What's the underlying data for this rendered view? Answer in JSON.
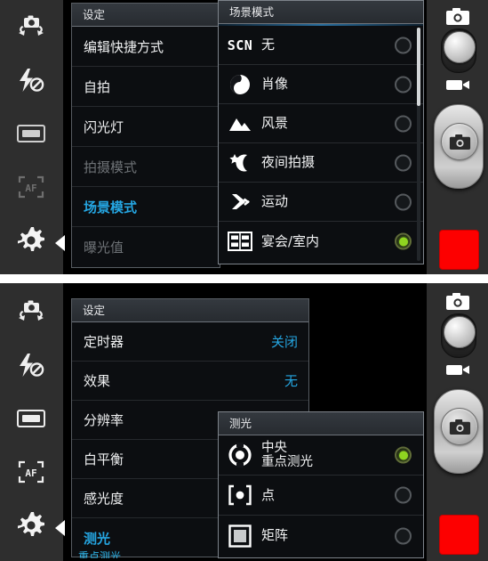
{
  "screens": [
    {
      "id": "scene-mode-screen",
      "sidebar": {
        "items": [
          {
            "name": "camera-switch-icon",
            "state": "enabled"
          },
          {
            "name": "flash-off-icon",
            "state": "enabled"
          },
          {
            "name": "screen-frame-icon",
            "state": "enabled"
          },
          {
            "name": "autofocus-icon",
            "state": "disabled"
          },
          {
            "name": "settings-gear-icon",
            "state": "selected"
          }
        ]
      },
      "settings_panel": {
        "title": "设定",
        "rows": [
          {
            "label": "编辑快捷方式",
            "value": "",
            "state": "normal"
          },
          {
            "label": "自拍",
            "value": "",
            "state": "normal"
          },
          {
            "label": "闪光灯",
            "value": "",
            "state": "normal"
          },
          {
            "label": "拍摄模式",
            "value": "",
            "state": "disabled"
          },
          {
            "label": "场景模式",
            "value": "",
            "state": "active"
          },
          {
            "label": "曝光值",
            "value": "",
            "state": "disabled"
          }
        ]
      },
      "option_panel": {
        "title": "场景模式",
        "options": [
          {
            "icon": "scn-text-icon",
            "label": "无",
            "selected": false
          },
          {
            "icon": "portrait-icon",
            "label": "肖像",
            "selected": false
          },
          {
            "icon": "landscape-icon",
            "label": "风景",
            "selected": false
          },
          {
            "icon": "night-icon",
            "label": "夜间拍摄",
            "selected": false
          },
          {
            "icon": "sports-icon",
            "label": "运动",
            "selected": false
          },
          {
            "icon": "party-indoor-icon",
            "label": "宴会/室内",
            "selected": true
          }
        ],
        "scroll_position": "top"
      },
      "controls": {
        "photo_mode_icon": "camera-icon",
        "video_mode_icon": "video-camera-icon",
        "shutter_icon": "camera-icon",
        "gallery_thumb_color": "#fd0000"
      }
    },
    {
      "id": "metering-screen",
      "sidebar": {
        "items": [
          {
            "name": "camera-switch-icon",
            "state": "enabled"
          },
          {
            "name": "flash-off-icon",
            "state": "enabled"
          },
          {
            "name": "screen-frame-icon",
            "state": "enabled"
          },
          {
            "name": "autofocus-icon",
            "state": "enabled"
          },
          {
            "name": "settings-gear-icon",
            "state": "selected"
          }
        ]
      },
      "settings_panel": {
        "title": "设定",
        "rows": [
          {
            "label": "定时器",
            "value": "关闭",
            "state": "normal"
          },
          {
            "label": "效果",
            "value": "无",
            "state": "normal"
          },
          {
            "label": "分辨率",
            "value": "",
            "state": "normal"
          },
          {
            "label": "白平衡",
            "value": "",
            "state": "normal"
          },
          {
            "label": "感光度",
            "value": "",
            "state": "normal"
          },
          {
            "label": "测光",
            "value": "",
            "state": "active"
          }
        ]
      },
      "option_panel": {
        "title": "测光",
        "options": [
          {
            "icon": "center-weighted-icon",
            "label": "中央\n重点测光",
            "selected": true
          },
          {
            "icon": "spot-metering-icon",
            "label": "点",
            "selected": false
          },
          {
            "icon": "matrix-metering-icon",
            "label": "矩阵",
            "selected": false
          }
        ]
      },
      "cutoff_text": "重点测光",
      "controls": {
        "photo_mode_icon": "camera-icon",
        "video_mode_icon": "video-camera-icon",
        "shutter_icon": "camera-icon",
        "gallery_thumb_color": "#fd0000"
      }
    }
  ],
  "colors": {
    "accent_blue": "#25a6e2",
    "selected_green": "#8fd520",
    "shutter_red": "#fd0000",
    "panel_bg": "#0c0e11",
    "rail_bg": "#2e2e2e"
  }
}
